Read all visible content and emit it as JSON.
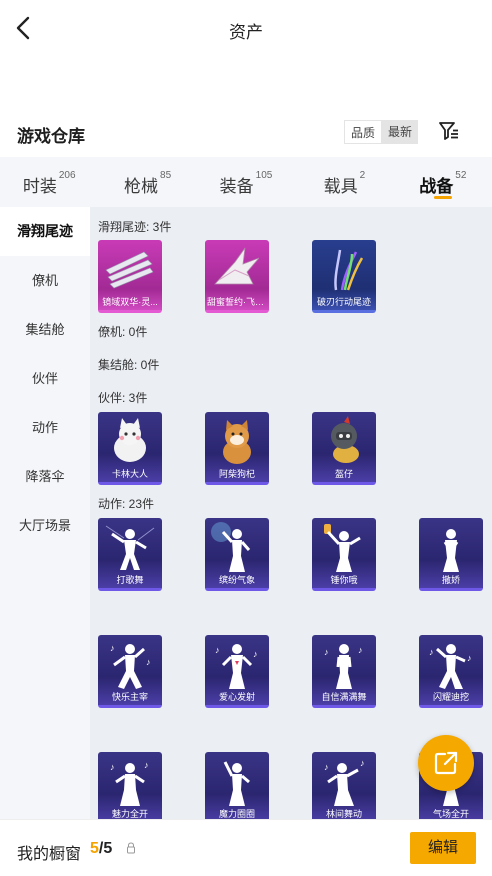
{
  "header": {
    "title": "资产"
  },
  "warehouse": {
    "title": "游戏仓库",
    "sort_options": [
      "品质",
      "最新"
    ]
  },
  "tabs": [
    {
      "label": "时装",
      "count": "206"
    },
    {
      "label": "枪械",
      "count": "85"
    },
    {
      "label": "装备",
      "count": "105"
    },
    {
      "label": "载具",
      "count": "2"
    },
    {
      "label": "战备",
      "count": "52"
    }
  ],
  "sidebar": [
    "滑翔尾迹",
    "僚机",
    "集结舱",
    "伙伴",
    "动作",
    "降落伞",
    "大厅场景"
  ],
  "sections": {
    "glide": {
      "title": "滑翔尾迹: 3件",
      "items": [
        "镜域双华·灵...",
        "甜蜜誓约·飞行...",
        "破刃行动尾迹"
      ]
    },
    "wingman": {
      "title": "僚机: 0件"
    },
    "capsule": {
      "title": "集结舱: 0件"
    },
    "partner": {
      "title": "伙伴: 3件",
      "items": [
        "卡林大人",
        "阿柴狗杞",
        "盔仔"
      ]
    },
    "emote": {
      "title": "动作: 23件",
      "items": [
        "打歌舞",
        "缤纷气象",
        "锤你哦",
        "撒娇",
        "快乐主宰",
        "爱心发射",
        "自信满满舞",
        "闪耀迪挖",
        "魅力全开",
        "魔力圈圈",
        "林间舞动",
        "气场全开"
      ]
    }
  },
  "bottom": {
    "window_label": "我的橱窗",
    "current": "5",
    "total": "/5",
    "edit_label": "编辑"
  },
  "colors": {
    "accent": "#f5a800",
    "tab_bg": "#f4f6f9",
    "content_bg": "#ebeef3",
    "card_purple": "#3a3486",
    "card_pink": "#c93bb6"
  }
}
